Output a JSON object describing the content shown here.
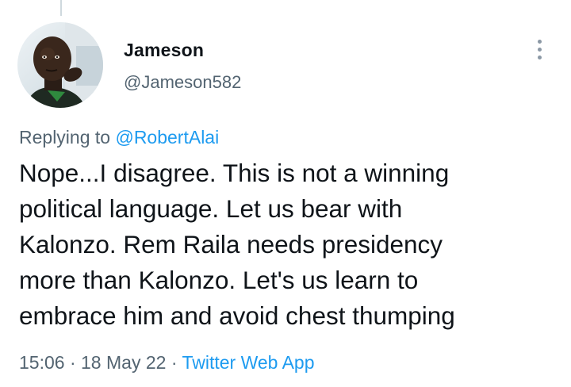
{
  "tweet": {
    "author": {
      "display_name": "Jameson",
      "handle": "@Jameson582"
    },
    "replying_prefix": "Replying to",
    "replying_to": "@RobertAlai",
    "text_lines": [
      "Nope...I disagree. This is not a winning",
      "political language. Let us bear with",
      "Kalonzo. Rem Raila needs presidency",
      "more than Kalonzo. Let's us learn to",
      "embrace him and avoid chest thumping"
    ],
    "time": "15:06",
    "separator": "·",
    "date": "18 May 22",
    "source": "Twitter Web App"
  },
  "colors": {
    "primary_text": "#0f1419",
    "secondary_text": "#536471",
    "link": "#1d9bf0",
    "thread_line": "#cfd9de"
  },
  "icons": {
    "more": "more-vertical-icon"
  }
}
